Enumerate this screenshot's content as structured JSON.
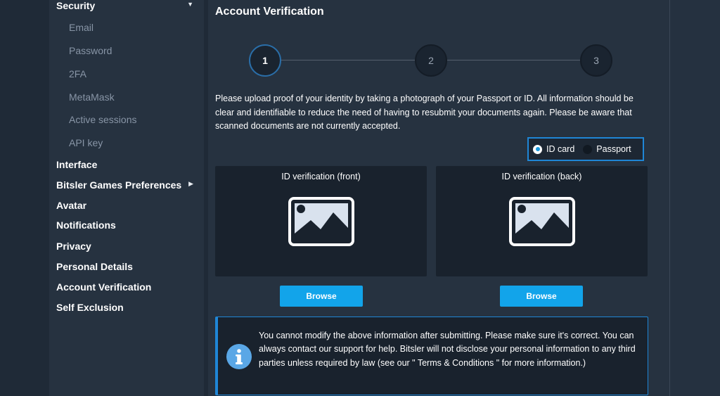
{
  "sidebar": {
    "security": {
      "label": "Security",
      "arrow": "▼"
    },
    "security_subitems": [
      "Email",
      "Password",
      "2FA",
      "MetaMask",
      "Active sessions",
      "API key"
    ],
    "interface": "Interface",
    "games_prefs": {
      "label": "Bitsler Games Preferences",
      "arrow": "▶"
    },
    "avatar": "Avatar",
    "notifications": "Notifications",
    "privacy": "Privacy",
    "personal_details": "Personal Details",
    "account_verification": "Account Verification",
    "self_exclusion": "Self Exclusion"
  },
  "main": {
    "title": "Account Verification",
    "steps": [
      "1",
      "2",
      "3"
    ],
    "active_step": "1",
    "instructions": "Please upload proof of your identity by taking a photograph of your Passport or ID. All information should be clear and identifiable to reduce the need of having to resubmit your documents again. Please be aware that scanned documents are not currently accepted.",
    "doc_type": {
      "options": [
        "ID card",
        "Passport"
      ],
      "selected": "ID card"
    },
    "front_title": "ID verification (front)",
    "back_title": "ID verification (back)",
    "browse_label": "Browse",
    "info_text": "You cannot modify the above information after submitting. Please make sure it's correct. You can always contact our support for help. Bitsler will not disclose your personal information to any third parties unless required by law (see our \" Terms & Conditions \" for more information.)"
  },
  "colors": {
    "accent": "#12a4ea",
    "border_accent": "#1f86d6",
    "panel_bg": "#263240",
    "card_bg": "#19222d"
  }
}
